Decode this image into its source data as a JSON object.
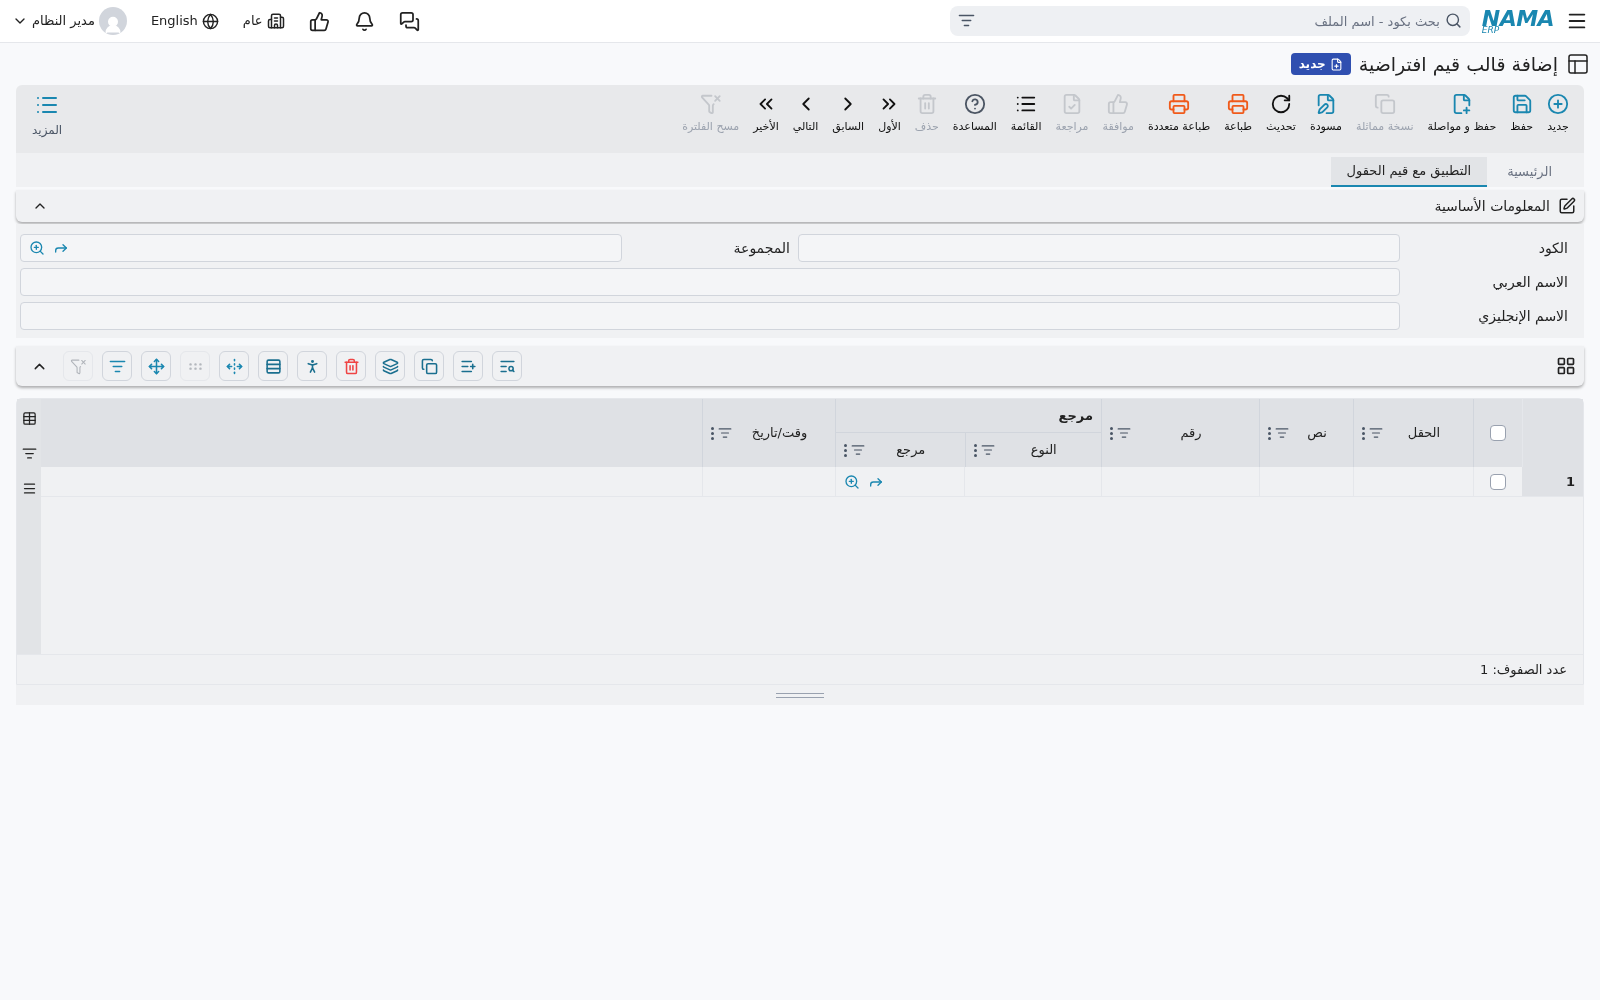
{
  "topbar": {
    "logo": "NAMA",
    "logo_sub": "ERP",
    "search": {
      "placeholder": "بحث بكود - اسم الملف"
    },
    "branch": "عام",
    "language": "English",
    "user": "مدير النظام"
  },
  "page": {
    "title": "إضافة قالب قيم افتراضية",
    "badge": "جديد"
  },
  "toolbar": [
    {
      "label": "جديد",
      "color": "#1a87b0",
      "disabled": false
    },
    {
      "label": "حفظ",
      "color": "#1a87b0",
      "disabled": false
    },
    {
      "label": "حفظ و مواصلة",
      "color": "#1a87b0",
      "disabled": false
    },
    {
      "label": "نسخة مماثلة",
      "disabled": true
    },
    {
      "label": "مسودة",
      "color": "#1a87b0",
      "disabled": false
    },
    {
      "label": "تحديث",
      "color": "#111111",
      "disabled": false
    },
    {
      "label": "طباعة",
      "color": "#f05a1a",
      "disabled": false
    },
    {
      "label": "طباعة متعددة",
      "color": "#f05a1a",
      "disabled": false
    },
    {
      "label": "موافقة",
      "disabled": true
    },
    {
      "label": "مراجعة",
      "disabled": true
    },
    {
      "label": "القائمة",
      "color": "#111111",
      "disabled": false
    },
    {
      "label": "المساعدة",
      "color": "#4b5563",
      "disabled": false
    },
    {
      "label": "حذف",
      "disabled": true
    },
    {
      "label": "الأول",
      "color": "#111111",
      "disabled": false
    },
    {
      "label": "السابق",
      "color": "#111111",
      "disabled": false
    },
    {
      "label": "التالي",
      "color": "#111111",
      "disabled": false
    },
    {
      "label": "الأخير",
      "color": "#111111",
      "disabled": false
    },
    {
      "label": "مسح الفلترة",
      "disabled": true
    }
  ],
  "more": "المزيد",
  "tabs": [
    {
      "label": "الرئيسية",
      "selected": false
    },
    {
      "label": "التطبيق مع قيم الحقول",
      "selected": true
    }
  ],
  "section": {
    "title": "المعلومات الأساسية",
    "expanded": true,
    "fields": [
      {
        "label": "الكود",
        "kind": "text"
      },
      {
        "label": "المجموعة",
        "kind": "reference"
      },
      {
        "label": "الاسم العربي",
        "kind": "text"
      },
      {
        "label": "الاسم الإنجليزي",
        "kind": "text"
      }
    ]
  },
  "grid_toolbar": {
    "expanded": true,
    "buttons": [
      {
        "disabled": true
      },
      {
        "disabled": false
      },
      {
        "disabled": false
      },
      {
        "disabled": true
      },
      {
        "disabled": false
      },
      {
        "disabled": false
      },
      {
        "disabled": false
      },
      {
        "disabled": false
      },
      {
        "disabled": false
      },
      {
        "disabled": false
      },
      {
        "disabled": false
      },
      {
        "disabled": false
      }
    ]
  },
  "table": {
    "columns": [
      "الحقل",
      "نص",
      "رقم"
    ],
    "group": {
      "label": "مرجع",
      "columns": [
        "النوع",
        "مرجع"
      ]
    },
    "last_column": "وقت/تاريخ",
    "rows": [
      {
        "number": "1",
        "checked": false
      }
    ],
    "header_checked": false,
    "footer": "عدد الصفوف: 1"
  }
}
